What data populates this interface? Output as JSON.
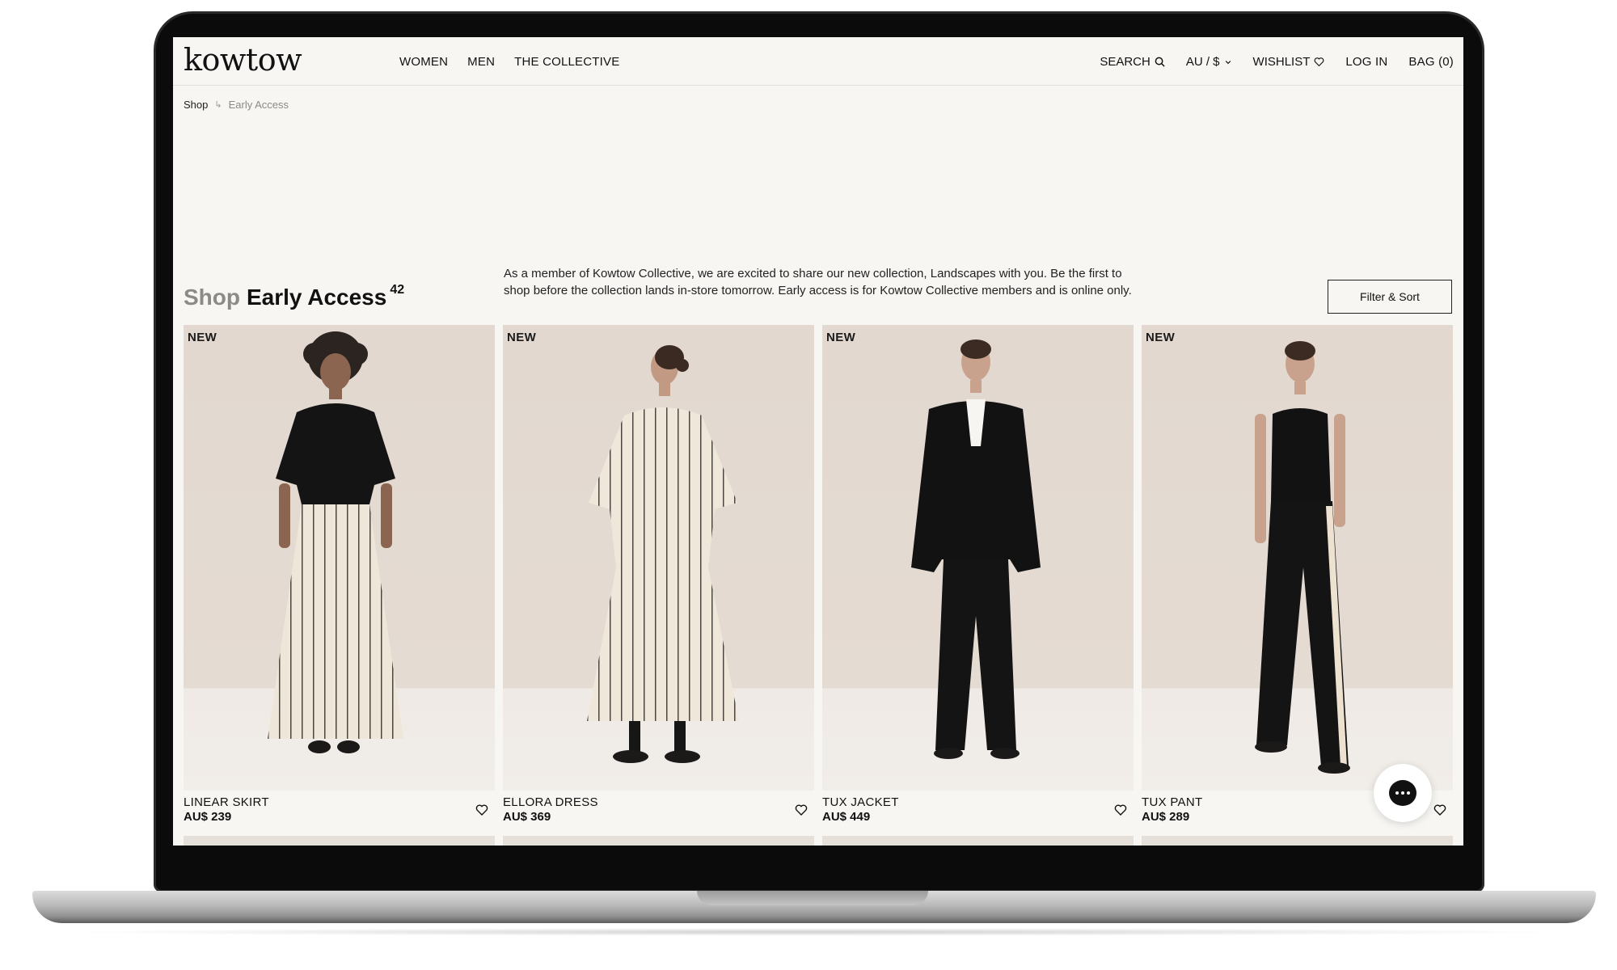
{
  "site": {
    "logo": "kowtow"
  },
  "nav": {
    "items": [
      "WOMEN",
      "MEN",
      "THE COLLECTIVE"
    ]
  },
  "utility": {
    "search": "SEARCH",
    "currency": "AU / $",
    "wishlist": "WISHLIST",
    "login": "LOG IN",
    "bag": "BAG (0)"
  },
  "breadcrumb": {
    "home": "Shop",
    "separator": "↳",
    "current": "Early Access"
  },
  "intro": {
    "title_light": "Shop",
    "title_dark": "Early Access",
    "count": "42",
    "text": "As a member of Kowtow Collective, we are excited to share our new collection, Landscapes with you. Be the first to shop before the collection lands in-store tomorrow. Early access is for Kowtow Collective members and is online only."
  },
  "filter": {
    "label": "Filter & Sort"
  },
  "products": [
    {
      "badge": "NEW",
      "name": "LINEAR SKIRT",
      "price": "AU$ 239"
    },
    {
      "badge": "NEW",
      "name": "ELLORA DRESS",
      "price": "AU$ 369"
    },
    {
      "badge": "NEW",
      "name": "TUX JACKET",
      "price": "AU$ 449"
    },
    {
      "badge": "NEW",
      "name": "TUX PANT",
      "price": "AU$ 289"
    }
  ],
  "colors": {
    "page_bg": "#f7f6f3",
    "photo_bg": "#e9e2dc",
    "text": "#111111",
    "muted": "#8d8a86"
  },
  "icons": {
    "search": "search-icon",
    "chevron": "chevron-down-icon",
    "wishlist": "heart-icon",
    "chat": "chat-icon"
  }
}
